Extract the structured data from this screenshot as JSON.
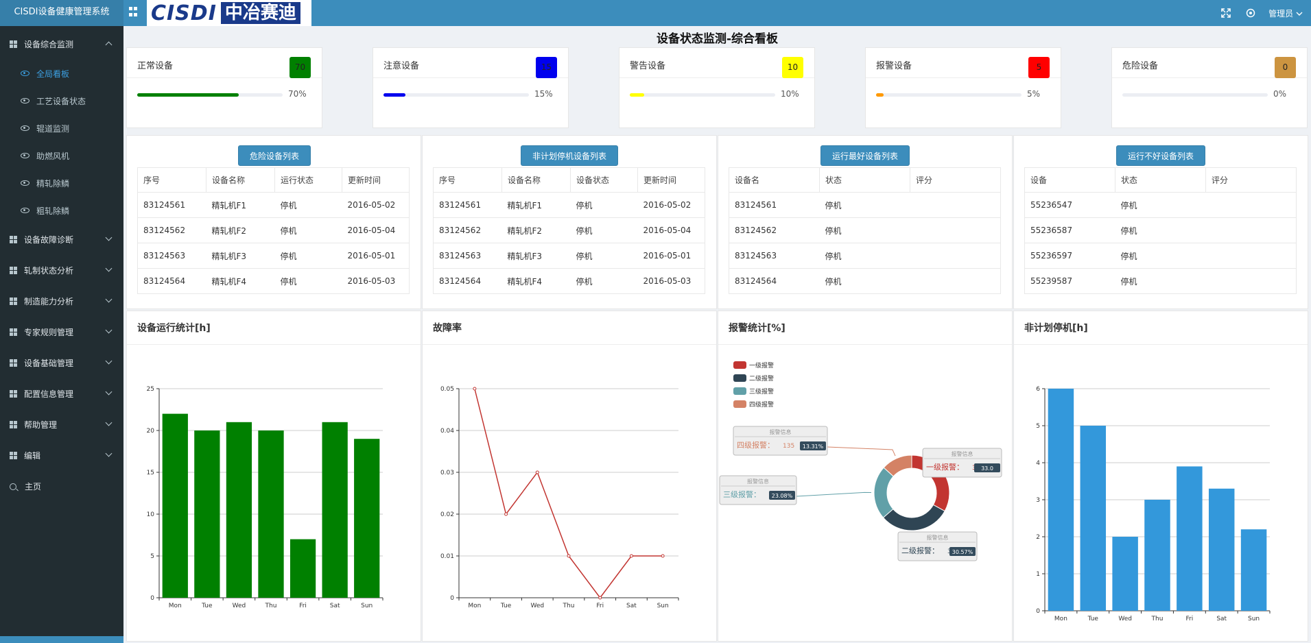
{
  "app": {
    "brand": "CISDI设备健康管理系统",
    "logo_latin": "CISDI",
    "logo_cn": "中冶赛迪",
    "user": "管理员"
  },
  "sidebar": {
    "items": [
      {
        "label": "设备综合监测",
        "expanded": true
      },
      {
        "label": "设备故障诊断"
      },
      {
        "label": "轧制状态分析"
      },
      {
        "label": "制造能力分析"
      },
      {
        "label": "专家规则管理"
      },
      {
        "label": "设备基础管理"
      },
      {
        "label": "配置信息管理"
      },
      {
        "label": "帮助管理"
      },
      {
        "label": "编辑"
      }
    ],
    "subitems": [
      "全局看板",
      "工艺设备状态",
      "辊道监测",
      "助燃风机",
      "精轧除鳞",
      "粗轧除鳞"
    ],
    "home": "主页"
  },
  "page_title": "设备状态监测-综合看板",
  "stats": [
    {
      "label": "正常设备",
      "count": "70",
      "percent": 70,
      "percent_label": "70%",
      "color": "#008000"
    },
    {
      "label": "注意设备",
      "count": "15",
      "percent": 15,
      "percent_label": "15%",
      "color": "#0000ee"
    },
    {
      "label": "警告设备",
      "count": "10",
      "percent": 10,
      "percent_label": "10%",
      "color": "#ffff00"
    },
    {
      "label": "报警设备",
      "count": "5",
      "percent": 5,
      "percent_label": "5%",
      "color": "#ff0000"
    },
    {
      "label": "危险设备",
      "count": "0",
      "percent": 0,
      "percent_label": "0%",
      "color": "#cc9440"
    }
  ],
  "tables": [
    {
      "button": "危险设备列表",
      "headers": [
        "序号",
        "设备名称",
        "运行状态",
        "更新时间"
      ],
      "rows": [
        [
          "83124561",
          "精轧机F1",
          "停机",
          "2016-05-02"
        ],
        [
          "83124562",
          "精轧机F2",
          "停机",
          "2016-05-04"
        ],
        [
          "83124563",
          "精轧机F3",
          "停机",
          "2016-05-01"
        ],
        [
          "83124564",
          "精轧机F4",
          "停机",
          "2016-05-03"
        ]
      ]
    },
    {
      "button": "非计划停机设备列表",
      "headers": [
        "序号",
        "设备名称",
        "设备状态",
        "更新时间"
      ],
      "rows": [
        [
          "83124561",
          "精轧机F1",
          "停机",
          "2016-05-02"
        ],
        [
          "83124562",
          "精轧机F2",
          "停机",
          "2016-05-04"
        ],
        [
          "83124563",
          "精轧机F3",
          "停机",
          "2016-05-01"
        ],
        [
          "83124564",
          "精轧机F4",
          "停机",
          "2016-05-03"
        ]
      ]
    },
    {
      "button": "运行最好设备列表",
      "headers": [
        "设备名",
        "状态",
        "评分"
      ],
      "rows": [
        [
          "83124561",
          "停机",
          ""
        ],
        [
          "83124562",
          "停机",
          ""
        ],
        [
          "83124563",
          "停机",
          ""
        ],
        [
          "83124564",
          "停机",
          ""
        ]
      ]
    },
    {
      "button": "运行不好设备列表",
      "headers": [
        "设备",
        "状态",
        "评分"
      ],
      "rows": [
        [
          "55236547",
          "停机",
          ""
        ],
        [
          "55236587",
          "停机",
          ""
        ],
        [
          "55236597",
          "停机",
          ""
        ],
        [
          "55239587",
          "停机",
          ""
        ]
      ]
    }
  ],
  "charts": {
    "run_stats": {
      "title": "设备运行统计[h]"
    },
    "failure_rate": {
      "title": "故障率"
    },
    "alarm_stats": {
      "title": "报警统计[%]"
    },
    "unplanned_stop": {
      "title": "非计划停机[h]"
    }
  },
  "chart_data": [
    {
      "type": "bar",
      "title": "设备运行统计[h]",
      "categories": [
        "Mon",
        "Tue",
        "Wed",
        "Thu",
        "Fri",
        "Sat",
        "Sun"
      ],
      "values": [
        22,
        20,
        21,
        20,
        7,
        21,
        19
      ],
      "ylim": [
        0,
        25
      ],
      "yticks": [
        "0",
        "5",
        "10",
        "15",
        "20",
        "25"
      ],
      "color": "#008000",
      "grid": true
    },
    {
      "type": "line",
      "title": "故障率",
      "categories": [
        "Mon",
        "Tue",
        "Wed",
        "Thu",
        "Fri",
        "Sat",
        "Sun"
      ],
      "values": [
        0.05,
        0.02,
        0.03,
        0.01,
        0,
        0.01,
        0.01
      ],
      "ylim": [
        0,
        0.05
      ],
      "yticks": [
        "0",
        "0.01",
        "0.02",
        "0.03",
        "0.04",
        "0.05"
      ],
      "color": "#c23531",
      "grid": true
    },
    {
      "type": "pie",
      "title": "报警统计[%]",
      "legend_position": "top-left",
      "tooltip_title": "报警信息",
      "slices": [
        {
          "name": "一级报警",
          "value": 335,
          "percent": "33.0",
          "color": "#c23531"
        },
        {
          "name": "二级报警",
          "value": 310,
          "percent": "30.57%",
          "color": "#2f4554"
        },
        {
          "name": "三级报警",
          "value": 234,
          "percent": "23.08%",
          "color": "#61a0a8"
        },
        {
          "name": "四级报警",
          "value": 135,
          "percent": "13.31%",
          "color": "#d48265"
        }
      ]
    },
    {
      "type": "bar",
      "title": "非计划停机[h]",
      "categories": [
        "Mon",
        "Tue",
        "Wed",
        "Thu",
        "Fri",
        "Sat",
        "Sun"
      ],
      "values": [
        6,
        5,
        2,
        3,
        3.9,
        3.3,
        2.2
      ],
      "ylim": [
        0,
        6
      ],
      "yticks": [
        "0",
        "1",
        "2",
        "3",
        "4",
        "5",
        "6"
      ],
      "color": "#3398db",
      "grid": true
    }
  ]
}
